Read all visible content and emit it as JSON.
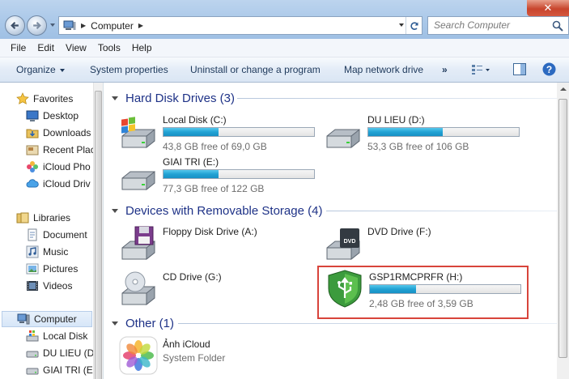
{
  "window": {
    "close_glyph": "✕"
  },
  "address": {
    "location": "Computer"
  },
  "search": {
    "placeholder": "Search Computer"
  },
  "menu": [
    "File",
    "Edit",
    "View",
    "Tools",
    "Help"
  ],
  "commands": {
    "organize": "Organize",
    "system_properties": "System properties",
    "uninstall": "Uninstall or change a program",
    "map_drive": "Map network drive",
    "more": "»"
  },
  "nav": {
    "favorites": "Favorites",
    "desktop": "Desktop",
    "downloads": "Downloads",
    "recent": "Recent Plac",
    "icloud_photos": "iCloud Pho",
    "icloud_drive": "iCloud Driv",
    "libraries": "Libraries",
    "documents": "Document",
    "music": "Music",
    "pictures": "Pictures",
    "videos": "Videos",
    "computer": "Computer",
    "local_disk": "Local Disk",
    "du_lieu": "DU LIEU (D",
    "giai_tri": "GIAI TRI (E:"
  },
  "groups": {
    "hdd": "Hard Disk Drives (3)",
    "removable": "Devices with Removable Storage (4)",
    "other": "Other (1)"
  },
  "drives": {
    "c": {
      "name": "Local Disk (C:)",
      "free": "43,8 GB free of 69,0 GB",
      "used_fraction": 0.365
    },
    "d": {
      "name": "DU LIEU (D:)",
      "free": "53,3 GB free of 106 GB",
      "used_fraction": 0.497
    },
    "e": {
      "name": "GIAI TRI (E:)",
      "free": "77,3 GB free of 122 GB",
      "used_fraction": 0.366
    },
    "floppy": {
      "name": "Floppy Disk Drive (A:)"
    },
    "dvd": {
      "name": "DVD Drive (F:)",
      "badge": "DVD"
    },
    "cd": {
      "name": "CD Drive (G:)"
    },
    "usb": {
      "name": "GSP1RMCPRFR (H:)",
      "free": "2,48 GB free of 3,59 GB",
      "used_fraction": 0.309
    }
  },
  "other": {
    "name": "Ảnh iCloud",
    "type": "System Folder"
  },
  "colors": {
    "group_title": "#1e3287",
    "bar_fill": "#22a2d4",
    "highlight": "#d8443b"
  }
}
